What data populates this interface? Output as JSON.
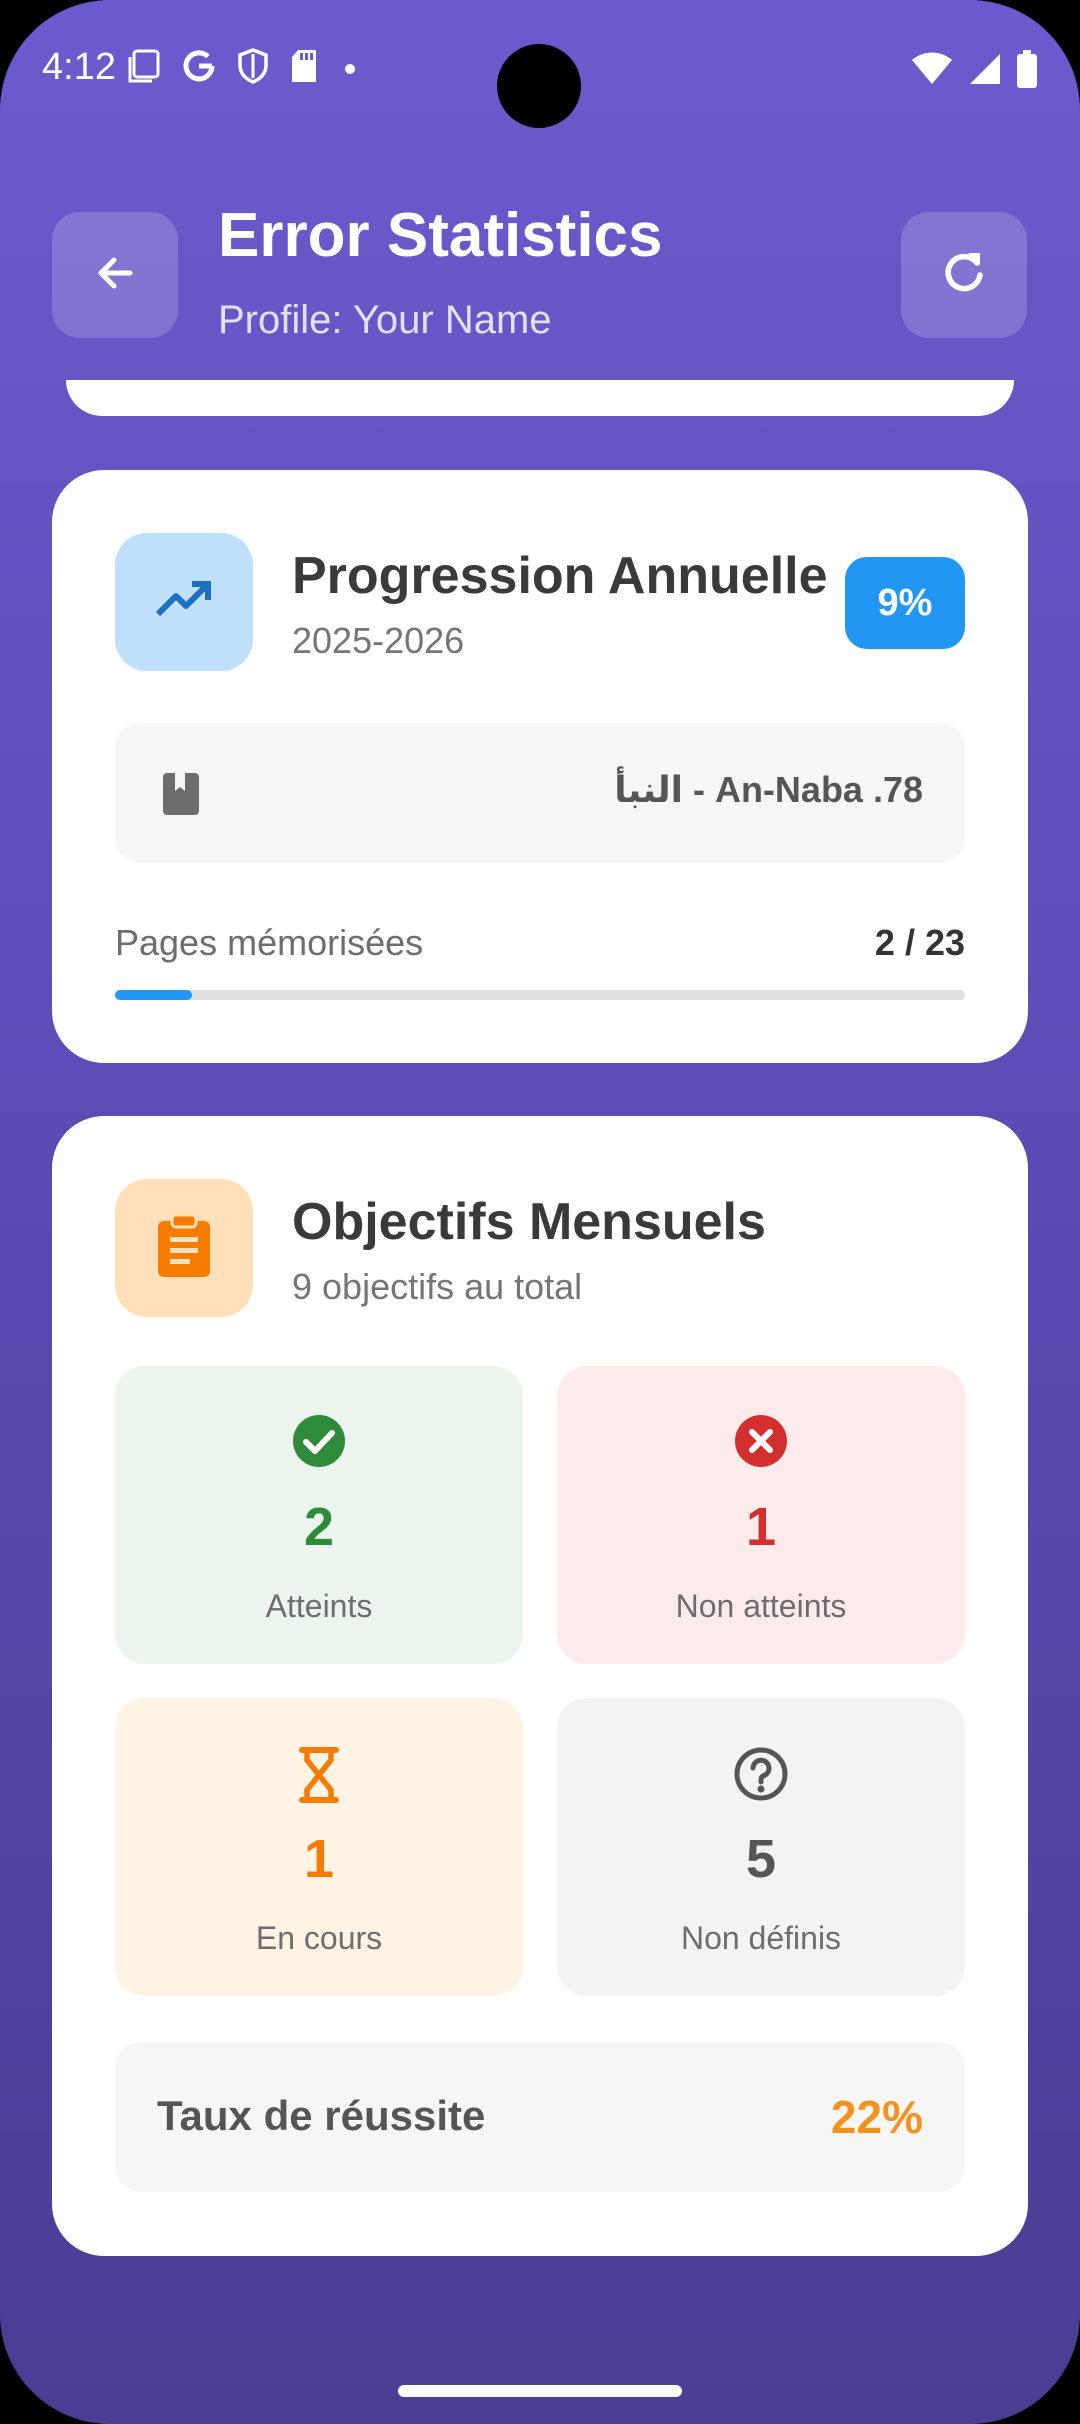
{
  "status_bar": {
    "time": "4:12",
    "left_icons": [
      "screenshot-icon",
      "google-icon",
      "shield-icon",
      "sd-card-icon",
      "dot-icon"
    ],
    "right_icons": [
      "wifi-icon",
      "signal-icon",
      "battery-icon"
    ]
  },
  "header": {
    "title": "Error Statistics",
    "subtitle": "Profile: Your Name",
    "back_icon": "arrow-back-icon",
    "refresh_icon": "refresh-icon"
  },
  "progress_card": {
    "icon": "trending-up-icon",
    "title": "Progression Annuelle",
    "subtitle": "2025-2026",
    "badge": "9%",
    "surah_icon": "book-icon",
    "surah": "النبأ - An-Naba .78",
    "pages_label": "Pages mémorisées",
    "pages_count": "2 / 23",
    "progress_fraction": 0.09
  },
  "goals_card": {
    "icon": "clipboard-icon",
    "title": "Objectifs Mensuels",
    "subtitle": "9 objectifs au total",
    "stats": [
      {
        "value": "2",
        "label": "Atteints",
        "icon": "check-circle-icon",
        "color": "#2e8b3a"
      },
      {
        "value": "1",
        "label": "Non atteints",
        "icon": "cancel-circle-icon",
        "color": "#d32f2f"
      },
      {
        "value": "1",
        "label": "En cours",
        "icon": "hourglass-icon",
        "color": "#f57c00"
      },
      {
        "value": "5",
        "label": "Non définis",
        "icon": "help-circle-icon",
        "color": "#555555"
      }
    ],
    "rate_label": "Taux de réussite",
    "rate_value": "22%"
  },
  "colors": {
    "accent": "#6b5bce",
    "blue": "#2196f3",
    "orange": "#f5921e"
  }
}
